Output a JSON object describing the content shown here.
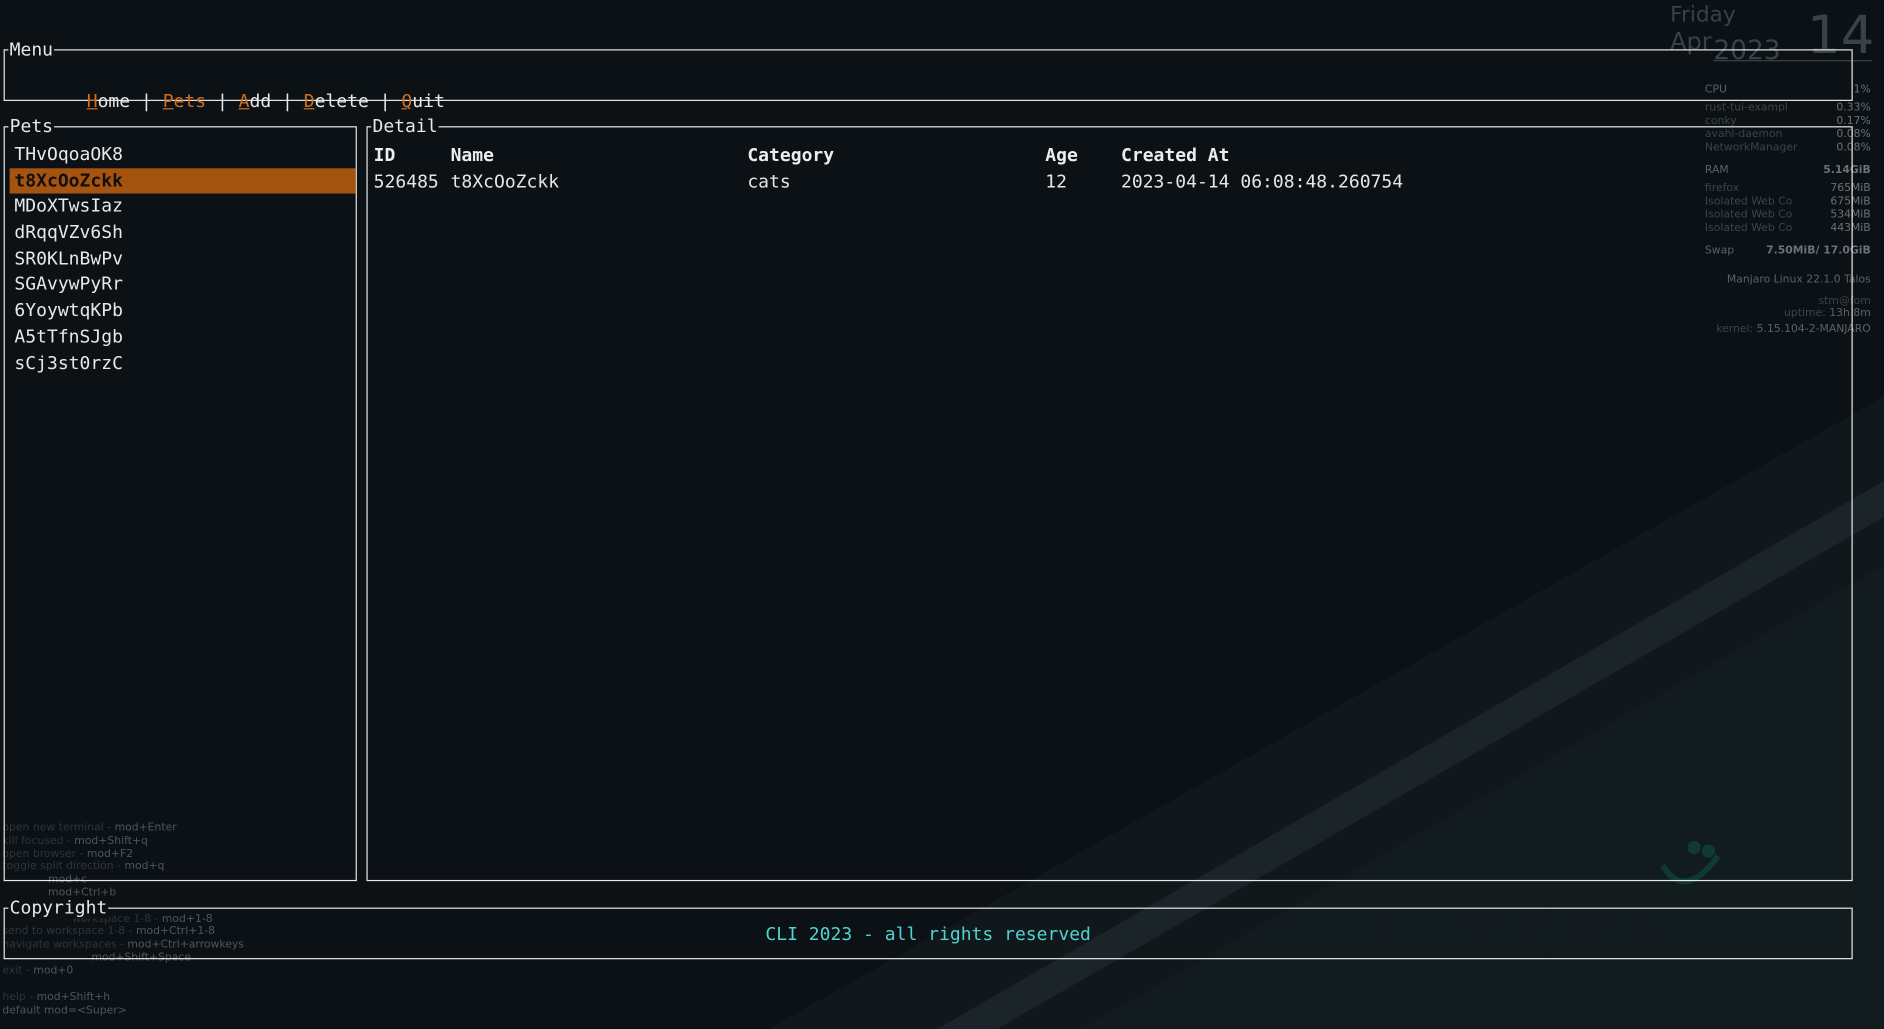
{
  "menu": {
    "title": "Menu",
    "items": [
      {
        "hotkey": "H",
        "rest": "ome"
      },
      {
        "hotkey": "P",
        "rest": "ets"
      },
      {
        "hotkey": "A",
        "rest": "dd"
      },
      {
        "hotkey": "D",
        "rest": "elete"
      },
      {
        "hotkey": "Q",
        "rest": "uit"
      }
    ],
    "separator": " | ",
    "active_index": 1
  },
  "pets_panel": {
    "title": "Pets",
    "items": [
      "THvOqoaOK8",
      "t8XcOoZckk",
      "MDoXTwsIaz",
      "dRqqVZv6Sh",
      "SR0KLnBwPv",
      "SGAvywPyRr",
      "6YoywtqKPb",
      "A5tTfnSJgb",
      "sCj3st0rzC"
    ],
    "selected_index": 1
  },
  "detail_panel": {
    "title": "Detail",
    "columns": [
      "ID",
      "Name",
      "Category",
      "Age",
      "Created At"
    ],
    "rows": [
      [
        "526485",
        "t8XcOoZckk",
        "cats",
        "12",
        "2023-04-14 06:08:48.260754"
      ]
    ]
  },
  "copyright_panel": {
    "title": "Copyright",
    "text": "CLI 2023 - all rights reserved"
  },
  "colors": {
    "accent": "#d16f1a",
    "selection_bg": "#a5540f",
    "footer_text": "#4fd4d1",
    "border": "#e8e8e8",
    "background": "#0c1115"
  },
  "desktop": {
    "clock": {
      "day": "Friday",
      "month": "Apr",
      "year": "2023",
      "date": "14"
    },
    "sysinfo": {
      "cpu_label": "CPU",
      "cpu_value": "1%",
      "cpu_procs": [
        {
          "name": "rust-tui-exampl",
          "value": "0.33%"
        },
        {
          "name": "conky",
          "value": "0.17%"
        },
        {
          "name": "avahi-daemon",
          "value": "0.08%"
        },
        {
          "name": "NetworkManager",
          "value": "0.08%"
        }
      ],
      "ram_label": "RAM",
      "ram_value": "5.14GiB",
      "ram_procs": [
        {
          "name": "firefox",
          "value": "765MiB"
        },
        {
          "name": "Isolated Web Co",
          "value": "675MiB"
        },
        {
          "name": "Isolated Web Co",
          "value": "534MiB"
        },
        {
          "name": "Isolated Web Co",
          "value": "443MiB"
        }
      ],
      "swap_label": "Swap",
      "swap_value": "7.50MiB/ 17.0GiB",
      "os": "Manjaro Linux 22.1.0 Talos",
      "host": "stm@fom",
      "uptime_label": "uptime:",
      "uptime_value": "13h 8m",
      "kernel_label": "kernel:",
      "kernel_value": "5.15.104-2-MANJARO"
    },
    "hints": [
      {
        "action": "open new terminal",
        "keys": "mod+Enter"
      },
      {
        "action": "kill focused",
        "keys": "mod+Shift+q"
      },
      {
        "action": "open browser",
        "keys": "mod+F2"
      },
      {
        "action": "toggle split direction",
        "keys": "mod+q"
      },
      {
        "action": "",
        "keys": "mod+c"
      },
      {
        "action": "",
        "keys": "mod+Ctrl+b"
      },
      {
        "action": "workspace 1-8",
        "keys": "mod+1-8"
      },
      {
        "action": "send to workspace 1-8",
        "keys": "mod+Ctrl+1-8"
      },
      {
        "action": "navigate workspaces",
        "keys": "mod+Ctrl+arrowkeys"
      },
      {
        "action": "",
        "keys": "mod+Shift+Space"
      },
      {
        "action": "exit",
        "keys": "mod+0"
      },
      {
        "action": "help",
        "keys": "mod+Shift+h"
      },
      {
        "action": "default mod=<Super>",
        "keys": ""
      }
    ],
    "brand": "manjaro"
  }
}
